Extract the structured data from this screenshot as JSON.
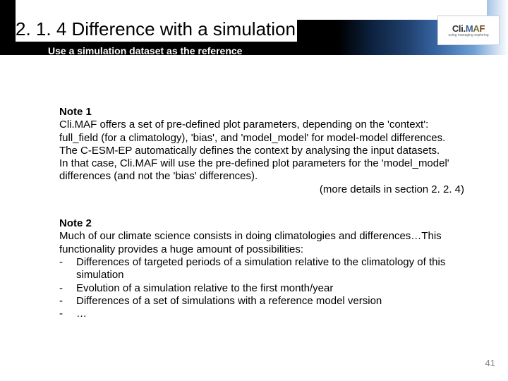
{
  "header": {
    "title": "2. 1. 4 Difference with a simulation",
    "subtitle": "Use a simulation dataset as the reference"
  },
  "logo": {
    "text_cli": "Cli.",
    "text_m": "M",
    "text_a": "A",
    "text_f": "F",
    "tagline": "using managing exploring"
  },
  "note1": {
    "heading": "Note 1",
    "p1": "Cli.MAF offers a set of pre-defined plot parameters, depending on the 'context': full_field (for a climatology), 'bias', and 'model_model' for model-model differences. The C-ESM-EP automatically defines the context by analysing the input datasets.",
    "p2": "In that case, Cli.MAF will use the pre-defined plot parameters for the 'model_model' differences (and not the 'bias' differences).",
    "more": "(more details in section 2. 2. 4)"
  },
  "note2": {
    "heading": "Note 2",
    "intro": "Much of our climate science consists in doing climatologies and differences…This functionality provides a huge amount of possibilities:",
    "bullets": [
      "Differences of targeted periods of a simulation relative to the climatology of this simulation",
      "Evolution of a simulation relative to the first month/year",
      "Differences of a set of simulations with a reference model version",
      "…"
    ]
  },
  "page_number": "41"
}
